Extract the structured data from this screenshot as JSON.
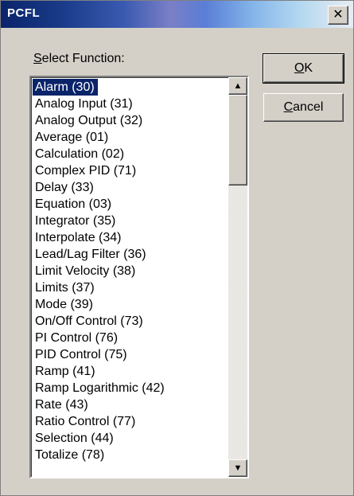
{
  "window": {
    "title": "PCFL",
    "close_glyph": "✕"
  },
  "label": {
    "prefix": "S",
    "rest": "elect Function:"
  },
  "buttons": {
    "ok_prefix": "O",
    "ok_rest": "K",
    "cancel_prefix": "C",
    "cancel_rest": "ancel"
  },
  "list": {
    "selected_index": 0,
    "items": [
      "Alarm  (30)",
      "Analog Input  (31)",
      "Analog Output  (32)",
      "Average  (01)",
      "Calculation  (02)",
      "Complex PID  (71)",
      "Delay  (33)",
      "Equation  (03)",
      "Integrator  (35)",
      "Interpolate  (34)",
      "Lead/Lag Filter  (36)",
      "Limit Velocity  (38)",
      "Limits  (37)",
      "Mode  (39)",
      "On/Off Control  (73)",
      "PI Control  (76)",
      "PID Control  (75)",
      "Ramp  (41)",
      "Ramp Logarithmic  (42)",
      "Rate  (43)",
      "Ratio Control  (77)",
      "Selection  (44)",
      "Totalize  (78)"
    ]
  },
  "scrollbar": {
    "up_glyph": "▲",
    "down_glyph": "▼",
    "position_fraction": 0.0
  }
}
